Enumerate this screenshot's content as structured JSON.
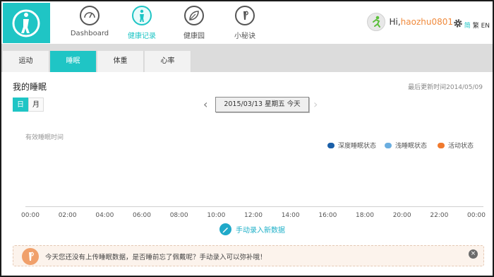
{
  "nav": {
    "items": [
      {
        "label": "Dashboard",
        "icon": "dashboard-gauge-icon",
        "active": false
      },
      {
        "label": "健康记录",
        "icon": "body-figure-icon",
        "active": true
      },
      {
        "label": "健康园",
        "icon": "leaf-icon",
        "active": false
      },
      {
        "label": "小秘诀",
        "icon": "tip-icon",
        "active": false
      }
    ]
  },
  "user": {
    "greeting": "Hi,",
    "name": "haozhu0801"
  },
  "lang": {
    "simplified": "简",
    "traditional": "繁",
    "english": "EN"
  },
  "tabs": [
    {
      "label": "运动",
      "active": false
    },
    {
      "label": "睡眠",
      "active": true
    },
    {
      "label": "体重",
      "active": false
    },
    {
      "label": "心率",
      "active": false
    }
  ],
  "main": {
    "title": "我的睡眠",
    "last_updated": "最后更新时间2014/05/09",
    "mode": {
      "day": "日",
      "month": "月"
    },
    "date": "2015/03/13 星期五 今天"
  },
  "chart_data": {
    "type": "bar",
    "title": "",
    "ylabel": "有效睡眠时间",
    "categories": [
      "00:00",
      "02:00",
      "04:00",
      "06:00",
      "08:00",
      "10:00",
      "12:00",
      "14:00",
      "16:00",
      "18:00",
      "20:00",
      "22:00",
      "00:00"
    ],
    "series": [
      {
        "name": "深度睡眠状态",
        "color": "#1a5fa8",
        "values": []
      },
      {
        "name": "浅睡眠状态",
        "color": "#6aaee0",
        "values": []
      },
      {
        "name": "活动状态",
        "color": "#f07a2e",
        "values": []
      }
    ],
    "grid": false,
    "legend": "top-right"
  },
  "manual_entry": "手动录入新数据",
  "notice": "今天您还没有上传睡眠数据，是否睡前忘了佩戴呢？手动录入可以弥补哦！",
  "colors": {
    "accent": "#1fc5c5",
    "orange": "#f08a3c"
  }
}
